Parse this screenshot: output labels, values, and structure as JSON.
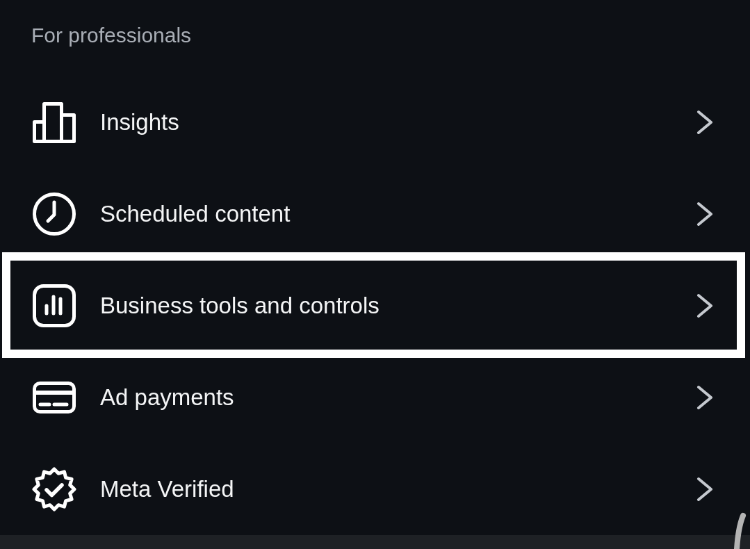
{
  "section": {
    "title": "For professionals"
  },
  "items": [
    {
      "label": "Insights",
      "highlighted": false
    },
    {
      "label": "Scheduled content",
      "highlighted": false
    },
    {
      "label": "Business tools and controls",
      "highlighted": true
    },
    {
      "label": "Ad payments",
      "highlighted": false
    },
    {
      "label": "Meta Verified",
      "highlighted": false
    }
  ]
}
